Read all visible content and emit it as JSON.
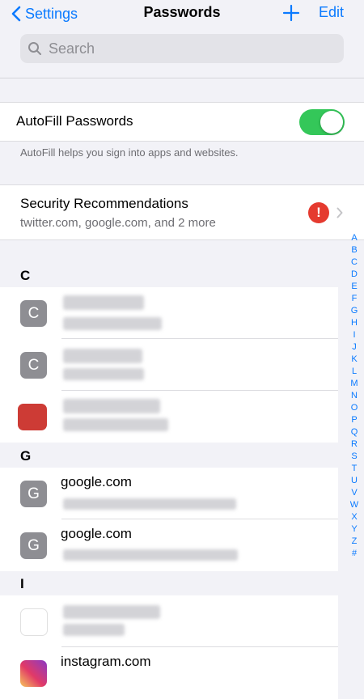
{
  "nav": {
    "back_label": "Settings",
    "title": "Passwords",
    "edit_label": "Edit"
  },
  "search": {
    "placeholder": "Search"
  },
  "autofill": {
    "label": "AutoFill Passwords",
    "enabled": true,
    "footnote": "AutoFill helps you sign into apps and websites."
  },
  "security": {
    "title": "Security Recommendations",
    "subtitle": "twitter.com, google.com, and 2 more",
    "alert_glyph": "!"
  },
  "sections": [
    {
      "letter": "C",
      "rows": [
        {
          "avatar": "C",
          "title": "",
          "subtitle": ""
        },
        {
          "avatar": "C",
          "title": "",
          "subtitle": ""
        },
        {
          "avatar": "",
          "title": "",
          "subtitle": ""
        }
      ]
    },
    {
      "letter": "G",
      "rows": [
        {
          "avatar": "G",
          "title": "google.com",
          "subtitle": ""
        },
        {
          "avatar": "G",
          "title": "google.com",
          "subtitle": ""
        }
      ]
    },
    {
      "letter": "I",
      "rows": [
        {
          "avatar": "",
          "title": "",
          "subtitle": ""
        },
        {
          "avatar": "",
          "title": "instagram.com",
          "subtitle": ""
        }
      ]
    }
  ],
  "index_letters": [
    "A",
    "B",
    "C",
    "D",
    "E",
    "F",
    "G",
    "H",
    "I",
    "J",
    "K",
    "L",
    "M",
    "N",
    "O",
    "P",
    "Q",
    "R",
    "S",
    "T",
    "U",
    "V",
    "W",
    "X",
    "Y",
    "Z",
    "#"
  ],
  "colors": {
    "accent": "#0a7aff",
    "toggle_on": "#34c759",
    "alert": "#e53a2f",
    "background": "#f2f2f7"
  }
}
